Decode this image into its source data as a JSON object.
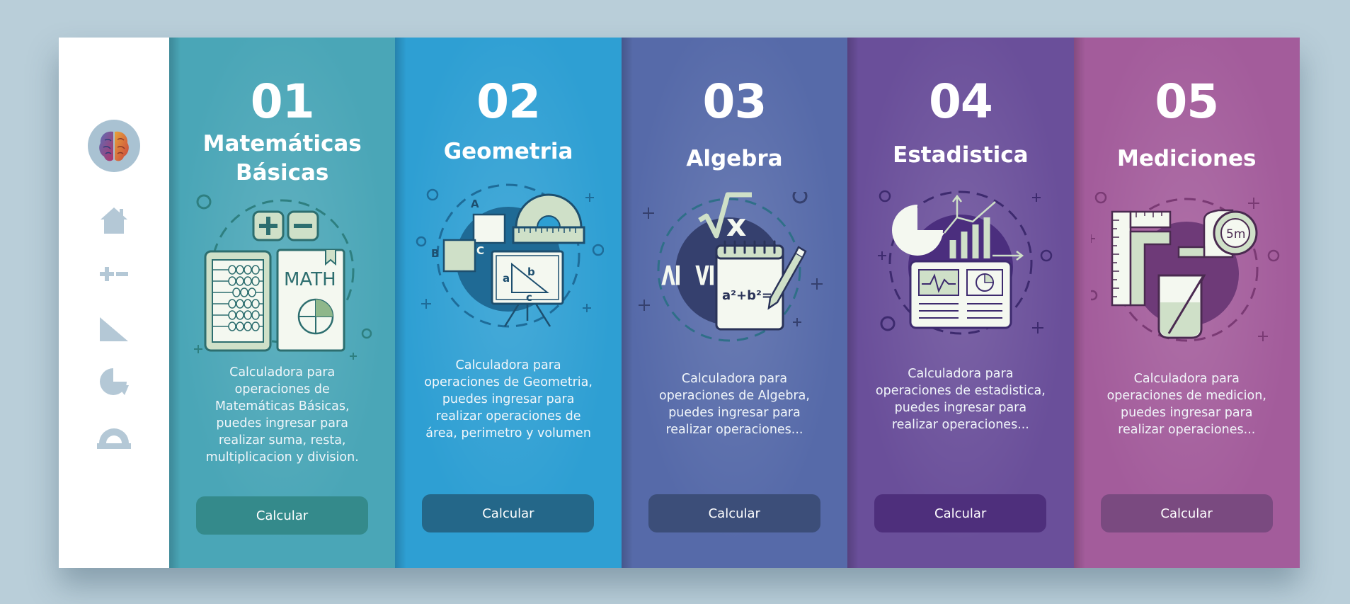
{
  "sidebar": {
    "logo_icon": "brain-icon",
    "items": [
      {
        "icon": "home-icon"
      },
      {
        "icon": "plus-minus-icon"
      },
      {
        "icon": "triangle-icon"
      },
      {
        "icon": "pie-chart-icon"
      },
      {
        "icon": "protractor-icon"
      }
    ]
  },
  "cards": [
    {
      "number": "01",
      "title": "Matemáticas Básicas",
      "description": "Calculadora para operaciones de Matemáticas Básicas, puedes ingresar para realizar suma, resta, multiplicacion y division.",
      "button": "Calcular",
      "color": "#4aa6b7",
      "illustration": "abacus-math-book-icon"
    },
    {
      "number": "02",
      "title": "Geometria",
      "description": "Calculadora para operaciones de Geometria, puedes ingresar para realizar operaciones de área, perimetro y volumen",
      "button": "Calcular",
      "color": "#2e9fd3",
      "illustration": "geometry-board-icon"
    },
    {
      "number": "03",
      "title": "Algebra",
      "description": "Calculadora para operaciones de Algebra, puedes ingresar para realizar operaciones...",
      "button": "Calcular",
      "color": "#566aa9",
      "illustration": "algebra-notepad-icon"
    },
    {
      "number": "04",
      "title": "Estadistica",
      "description": "Calculadora para operaciones de estadistica, puedes ingresar para realizar operaciones...",
      "button": "Calcular",
      "color": "#6a4f9a",
      "illustration": "statistics-dashboard-icon"
    },
    {
      "number": "05",
      "title": "Mediciones",
      "description": "Calculadora para operaciones de medicion, puedes ingresar para realizar operaciones...",
      "button": "Calcular",
      "color": "#a35c9b",
      "illustration": "measurement-tools-icon"
    }
  ],
  "illustration_labels": {
    "math_book": "MATH",
    "geometry_vertices": [
      "A",
      "B",
      "C"
    ],
    "triangle_sides": [
      "a",
      "b",
      "c"
    ],
    "algebra_symbols": [
      "≥",
      "≤",
      "x"
    ],
    "algebra_formula": "a²+b²=",
    "tape_measure": "5m"
  }
}
